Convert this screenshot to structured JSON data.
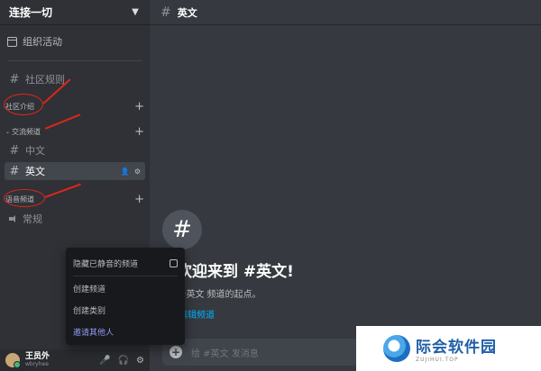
{
  "server": {
    "name": "连接一切"
  },
  "sidebar": {
    "events_label": "组织活动",
    "channels": [
      {
        "name": "社区规则"
      },
      {
        "name": "中文"
      },
      {
        "name": "英文"
      }
    ],
    "categories": [
      {
        "name": "社区介绍"
      },
      {
        "name": "交流频道"
      },
      {
        "name": "语音频道"
      }
    ],
    "voice_channels": [
      {
        "name": "常规"
      }
    ]
  },
  "user": {
    "name": "王员外",
    "tag": "wbryhee"
  },
  "context_menu": {
    "items": [
      {
        "label": "隐藏已静音的频道"
      },
      {
        "label": "创建频道"
      },
      {
        "label": "创建类别"
      },
      {
        "label": "邀请其他人"
      }
    ]
  },
  "main": {
    "channel_title": "英文",
    "welcome_title": "欢迎来到 #英文!",
    "welcome_subtitle": "#英文 频道的起点。",
    "edit_link": "编辑频道",
    "input_placeholder": "给 #英文 发消息"
  },
  "watermark": {
    "cn": "际会软件园",
    "en": "ZUJIHUI.TOP"
  },
  "colors": {
    "sidebar_bg": "#2f3136",
    "main_bg": "#36393f",
    "accent_link": "#00aff4",
    "annotation_red": "#e0261b",
    "invite_purple": "#949cf7"
  }
}
